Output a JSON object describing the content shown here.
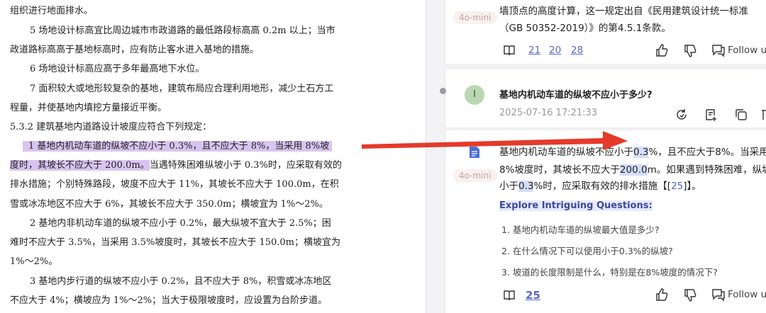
{
  "doc": {
    "lines": [
      {
        "text": "组织进行地面排水。",
        "hl": ""
      },
      {
        "text": "5 场地设计标高宜比周边城市市政道路的最低路段标高高 0.2m 以上；当市",
        "hl": ""
      },
      {
        "text": "政道路标高高于基地标高时，应有防止客水进入基地的措施。",
        "hl": ""
      },
      {
        "text": "6 场地设计标高应高于多年最高地下水位。",
        "hl": ""
      },
      {
        "text": "7 面积较大或地形较复杂的基地，建筑布局应合理利用地形，减少土石方工",
        "hl": ""
      },
      {
        "text": "程量，并使基地内填挖方量接近平衡。",
        "hl": ""
      },
      {
        "text": "5.3.2 建筑基地内道路设计坡度应符合下列规定：",
        "hl": ""
      },
      {
        "text": "",
        "hl": "1 基地内机动车道的纵坡不应小于 0.3%，且不应大于 8%，当采用 8%坡"
      },
      {
        "text": "当遇特殊困难纵坡小于 0.3%时，应采取有效的",
        "hl": "度时，其坡长不应大于 200.0m。"
      },
      {
        "text": "排水措施；个别特殊路段，坡度不应大于 11%，其坡长不应大于 100.0m，在积",
        "hl": ""
      },
      {
        "text": "雪或冰冻地区不应大于 6%，其坡长不应大于 350.0m；横坡宜为 1%～2%。",
        "hl": ""
      },
      {
        "text": "2 基地内非机动车道的纵坡不应小于 0.2%，最大纵坡不宜大于 2.5%；困",
        "hl": ""
      },
      {
        "text": "难时不应大于 3.5%，当采用 3.5%坡度时，其坡长不应大于 150.0m；横坡宜为",
        "hl": ""
      },
      {
        "text": "1%～2%。",
        "hl": ""
      },
      {
        "text": "3 基地内步行道的纵坡不应小于 0.2%，且不应大于 8%，积雪或冰冻地区",
        "hl": ""
      },
      {
        "text": "不应大于 4%；横坡应为 1%～2%；当大于极限坡度时，应设置为台阶步道。",
        "hl": ""
      }
    ]
  },
  "prev_answer": {
    "badge": "4o-mini",
    "line1": "墙顶点的高度计算，这一规定出自《民用建筑设计统一标准",
    "line2": "（GB 50352-2019）》的第4.5.1条款。",
    "refs": [
      "21",
      "20",
      "28"
    ],
    "follow": "Follow u"
  },
  "question": {
    "avatar": "I",
    "text": "基地内机动车道的纵坡不应小于多少?",
    "time": "2025-07-16 17:21:33"
  },
  "answer": {
    "badge": "4o-mini",
    "l1_a": "基地内机动车道的纵坡不应小于",
    "l1_h": "0.3",
    "l1_b": "%，且不应大于8%。当采用",
    "l2_a": "8%坡度时，其坡长不应大于",
    "l2_h": "200.0",
    "l2_b": "m。如果遇到特殊困难，纵坡",
    "l3_a": "小于",
    "l3_h": "0.3",
    "l3_b": "%时，应采取有效的排水措施【[",
    "l3_ref": "25",
    "l3_c": "]】。",
    "explore": "Explore Intriguing Questions:",
    "questions": [
      "1. 基地内机动车道的纵坡最大值是多少?",
      "2. 在什么情况下可以使用小于0.3%的纵坡?",
      "3. 坡道的长度限制是什么，特别是在8%坡度的情况下?"
    ],
    "ref": "25",
    "follow": "Follow u"
  },
  "colors": {
    "arrow": "#e53a2a",
    "highlight": "#d9c3f0",
    "link": "#5566cc"
  }
}
